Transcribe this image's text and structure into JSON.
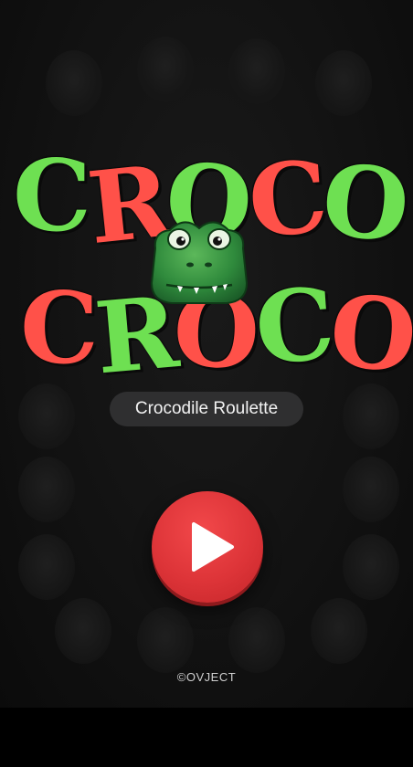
{
  "title": {
    "line1": [
      "C",
      "R",
      "O",
      "C",
      "O",
      "?"
    ],
    "line2": [
      "C",
      "R",
      "O",
      "C",
      "O",
      "!"
    ],
    "colors": {
      "green": "#6ee052",
      "red": "#ff5149"
    }
  },
  "subtitle": "Crocodile Roulette",
  "play": {
    "icon": "play-icon",
    "color": "#dd3438"
  },
  "footer": {
    "copyright_symbol": "©",
    "brand": "OVJECT"
  },
  "mascot": {
    "icon": "crocodile-head-icon"
  }
}
